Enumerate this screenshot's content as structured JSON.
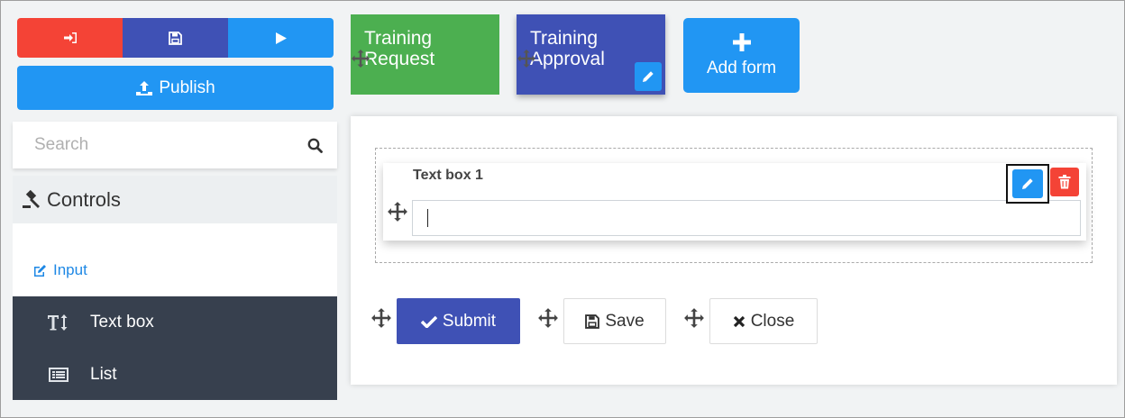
{
  "toolbar": {
    "exit_icon": "sign-out-icon",
    "save_icon": "floppy-disk-icon",
    "run_icon": "play-icon",
    "publish_label": "Publish",
    "publish_icon": "upload-icon"
  },
  "sidebar": {
    "search": {
      "placeholder": "Search",
      "value": ""
    },
    "controls_heading": "Controls",
    "category_label": "Input",
    "items": [
      {
        "label": "Text box",
        "icon": "text-height-icon"
      },
      {
        "label": "List",
        "icon": "list-icon"
      }
    ]
  },
  "forms": {
    "tabs": [
      {
        "label": "Training Request",
        "color": "#4caf50"
      },
      {
        "label": "Training Approval",
        "color": "#3f51b5"
      }
    ],
    "add_label": "Add form"
  },
  "canvas": {
    "field": {
      "label": "Text box 1",
      "value": ""
    },
    "buttons": {
      "submit": "Submit",
      "save": "Save",
      "close": "Close"
    }
  },
  "colors": {
    "red": "#f44336",
    "indigo": "#3f51b5",
    "blue": "#2196f3",
    "green": "#4caf50",
    "sidebar_dark": "#37404e"
  }
}
